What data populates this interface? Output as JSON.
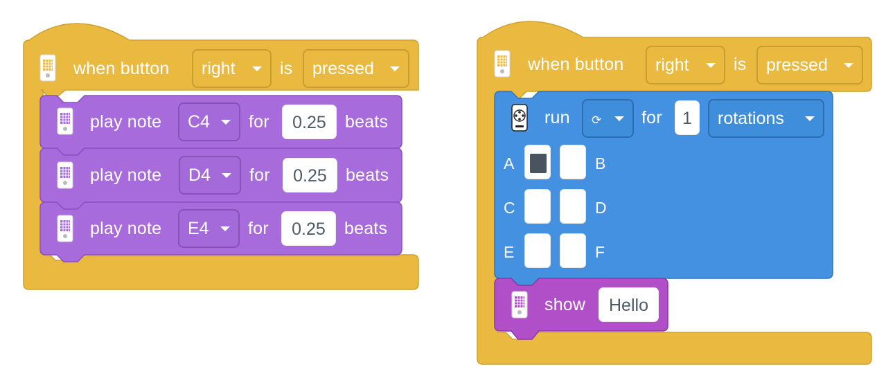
{
  "colors": {
    "event_yellow": "#e9b940",
    "sound_purple": "#a86bdc",
    "motor_blue": "#4391e0",
    "display_purple": "#b04fc8",
    "port_fill": "#4a5461"
  },
  "left_stack": {
    "hat": {
      "icon": "hub-icon",
      "label": "when button",
      "button_value": "right",
      "is_label": "is",
      "state_value": "pressed"
    },
    "notes": [
      {
        "icon": "hub-icon",
        "label": "play note",
        "note": "C4",
        "for_label": "for",
        "beats_value": "0.25",
        "beats_label": "beats"
      },
      {
        "icon": "hub-icon",
        "label": "play note",
        "note": "D4",
        "for_label": "for",
        "beats_value": "0.25",
        "beats_label": "beats"
      },
      {
        "icon": "hub-icon",
        "label": "play note",
        "note": "E4",
        "for_label": "for",
        "beats_value": "0.25",
        "beats_label": "beats"
      }
    ]
  },
  "right_stack": {
    "hat": {
      "icon": "hub-icon",
      "label": "when button",
      "button_value": "right",
      "is_label": "is",
      "state_value": "pressed"
    },
    "motor": {
      "icon": "motor-icon",
      "label": "run",
      "direction_icon": "clockwise-icon",
      "direction_glyph": "⟳",
      "for_label": "for",
      "amount": "1",
      "unit": "rotations",
      "ports": [
        {
          "name": "A",
          "selected": true
        },
        {
          "name": "B",
          "selected": false
        },
        {
          "name": "C",
          "selected": false
        },
        {
          "name": "D",
          "selected": false
        },
        {
          "name": "E",
          "selected": false
        },
        {
          "name": "F",
          "selected": false
        }
      ]
    },
    "show": {
      "icon": "hub-icon",
      "label": "show",
      "text_value": "Hello"
    }
  }
}
